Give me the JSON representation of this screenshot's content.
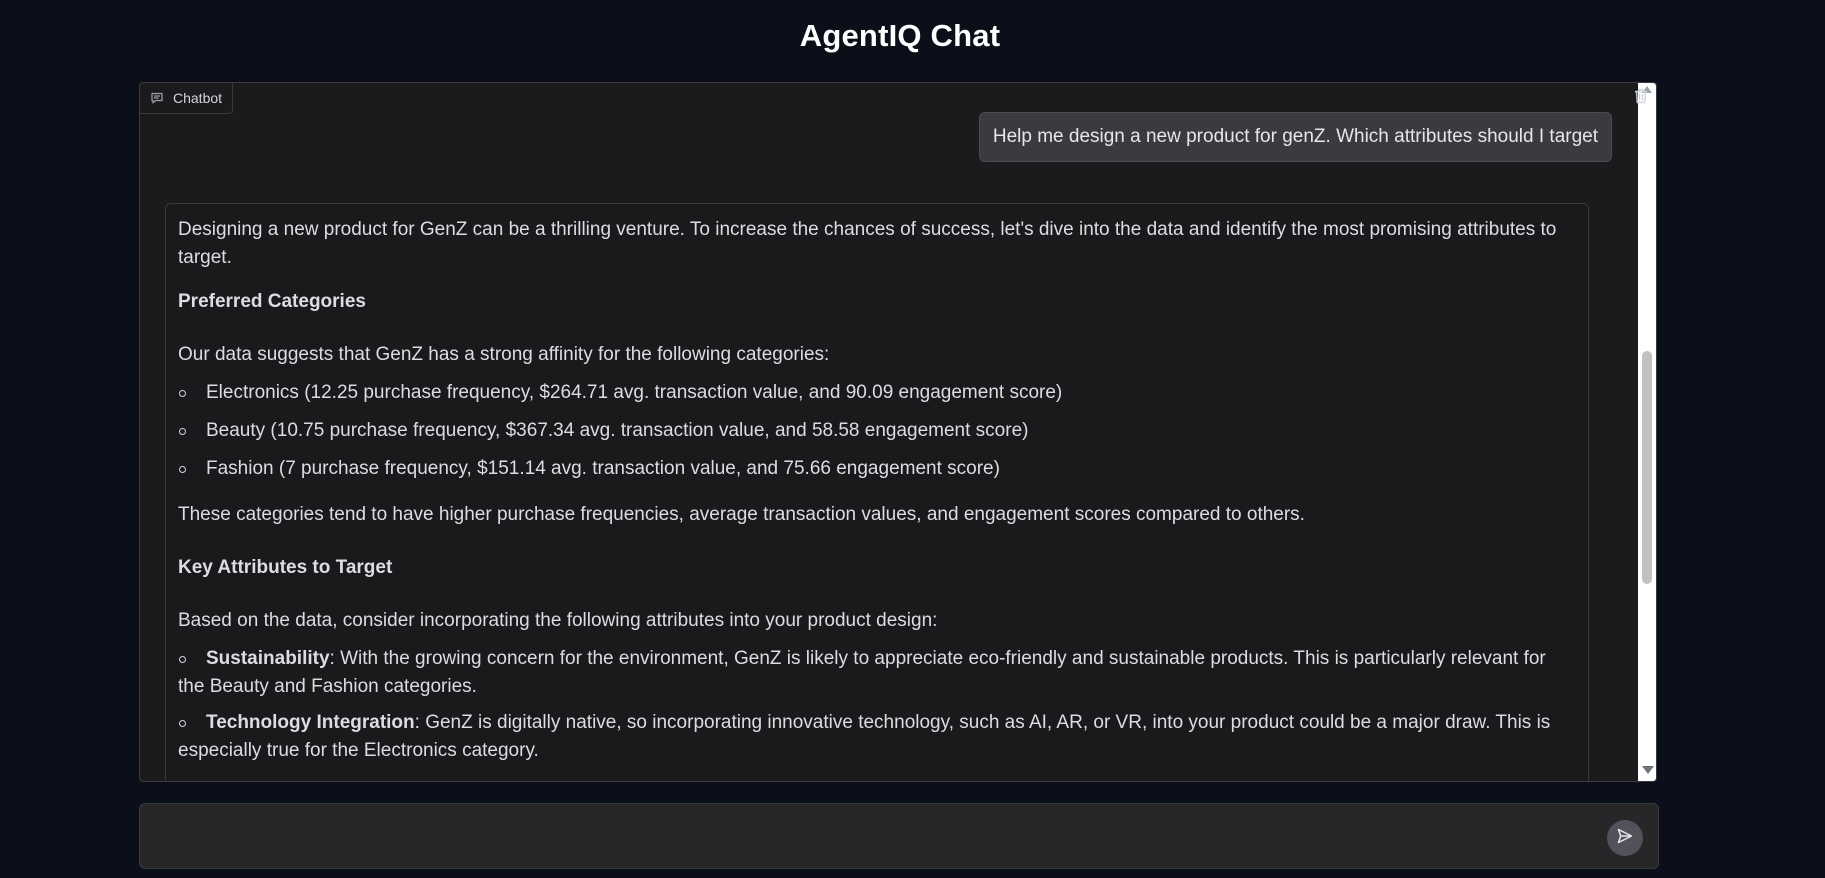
{
  "app": {
    "title": "AgentIQ Chat"
  },
  "chatbot": {
    "label": "Chatbot",
    "label_icon": "chat-bubble-icon",
    "clear_icon": "trash-icon"
  },
  "messages": {
    "user": {
      "text": "Help me design a new product for genZ. Which attributes should I target"
    },
    "bot": {
      "intro": "Designing a new product for GenZ can be a thrilling venture. To increase the chances of success, let's dive into the data and identify the most promising attributes to target.",
      "section1_heading": "Preferred Categories",
      "section1_intro": "Our data suggests that GenZ has a strong affinity for the following categories:",
      "categories": [
        "Electronics (12.25 purchase frequency, $264.71 avg. transaction value, and 90.09 engagement score)",
        "Beauty (10.75 purchase frequency, $367.34 avg. transaction value, and 58.58 engagement score)",
        "Fashion (7 purchase frequency, $151.14 avg. transaction value, and 75.66 engagement score)"
      ],
      "section1_summary": "These categories tend to have higher purchase frequencies, average transaction values, and engagement scores compared to others.",
      "section2_heading": "Key Attributes to Target",
      "section2_intro": "Based on the data, consider incorporating the following attributes into your product design:",
      "attributes": [
        {
          "name": "Sustainability",
          "text": ": With the growing concern for the environment, GenZ is likely to appreciate eco-friendly and sustainable products. This is particularly relevant for the Beauty and Fashion categories."
        },
        {
          "name": "Technology Integration",
          "text": ": GenZ is digitally native, so incorporating innovative technology, such as AI, AR, or VR, into your product could be a major draw. This is especially true for the Electronics category."
        }
      ]
    }
  },
  "input": {
    "placeholder": "",
    "value": "",
    "send_icon": "send-icon"
  },
  "colors": {
    "background": "#0b0f19",
    "panel": "#1b1b1d",
    "user_bubble": "#3a3b3f",
    "send_button": "#52525b"
  }
}
